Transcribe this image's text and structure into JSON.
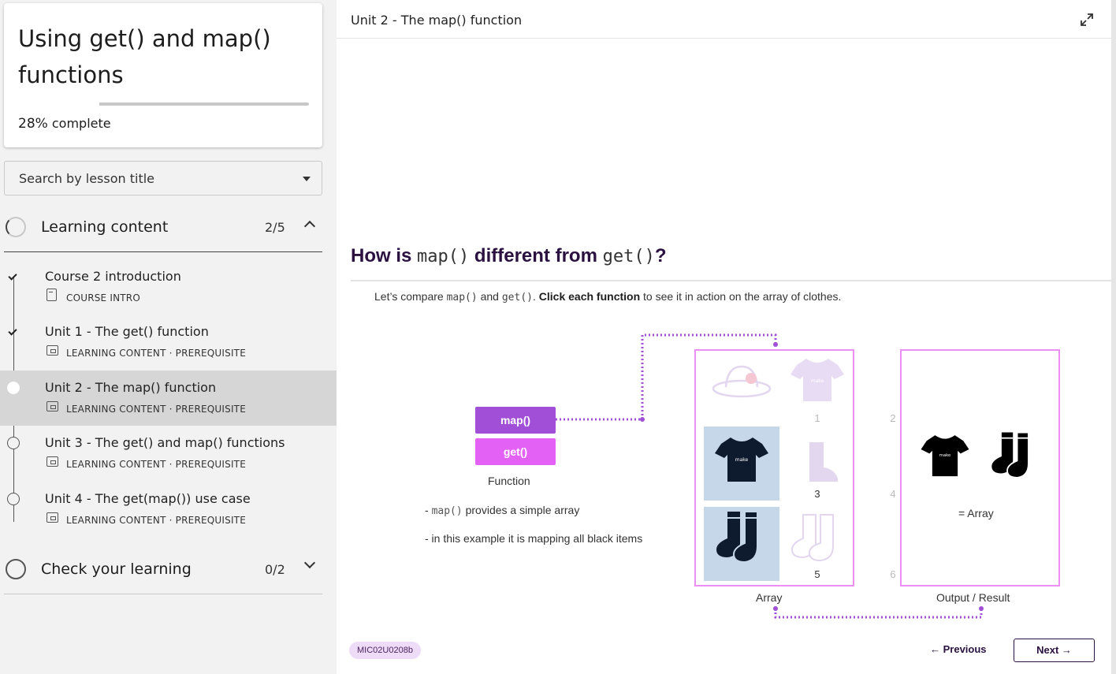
{
  "course": {
    "title": "Using get() and map() functions",
    "progress_value": "28%",
    "progress_suffix": " complete",
    "progress_fraction": 0.28
  },
  "search": {
    "label": "Search by lesson title"
  },
  "sections": [
    {
      "title": "Learning content",
      "count": "2/5"
    },
    {
      "title": "Check your learning",
      "count": "0/2"
    }
  ],
  "lessons": [
    {
      "title": "Course 2 introduction",
      "meta": "COURSE INTRO",
      "status": "done"
    },
    {
      "title": "Unit 1 - The get() function",
      "meta": "LEARNING CONTENT · PREREQUISITE",
      "status": "done"
    },
    {
      "title": "Unit 2 - The map() function",
      "meta": "LEARNING CONTENT · PREREQUISITE",
      "status": "current"
    },
    {
      "title": "Unit 3 - The get() and map() functions",
      "meta": "LEARNING CONTENT · PREREQUISITE",
      "status": "todo"
    },
    {
      "title": "Unit 4 - The get(map()) use case",
      "meta": "LEARNING CONTENT · PREREQUISITE",
      "status": "todo"
    }
  ],
  "main": {
    "unit_title": "Unit 2 - The map() function",
    "question": {
      "how_is": "How is ",
      "map_code": "map()",
      "different_from": " different from ",
      "get_code": "get()",
      "mark": "?"
    },
    "intro": {
      "prefix": "Let’s compare ",
      "map_code": "map()",
      "and": " and ",
      "get_code": "get()",
      "period": ". ",
      "bold": "Click each function",
      "suffix": " to see it in action on the array of clothes."
    },
    "buttons": {
      "map": "map()",
      "get": "get()"
    },
    "function_label": "Function",
    "note1": {
      "prefix": "- ",
      "code": "map()",
      "suffix": " provides a simple array"
    },
    "note2": "- in this example it is mapping all black items",
    "array": {
      "label": "Array",
      "items": [
        {
          "num": "1",
          "item": "hat",
          "highlighted": false
        },
        {
          "num": "2",
          "item": "t-shirt",
          "highlighted": false
        },
        {
          "num": "3",
          "item": "black t-shirt",
          "highlighted": true
        },
        {
          "num": "4",
          "item": "boot",
          "highlighted": false
        },
        {
          "num": "5",
          "item": "black socks",
          "highlighted": true
        },
        {
          "num": "6",
          "item": "socks",
          "highlighted": false
        }
      ]
    },
    "output": {
      "label": "Output / Result",
      "eq_label": "= Array"
    },
    "tag": "MIC02U0208b",
    "prev": "← Previous",
    "next": "Next →",
    "colors": {
      "map": "#a04fd6",
      "get": "#e361f4",
      "frame": "#ec8ff3",
      "highlight": "#c7d7ea",
      "dark": "#2a1140"
    }
  }
}
